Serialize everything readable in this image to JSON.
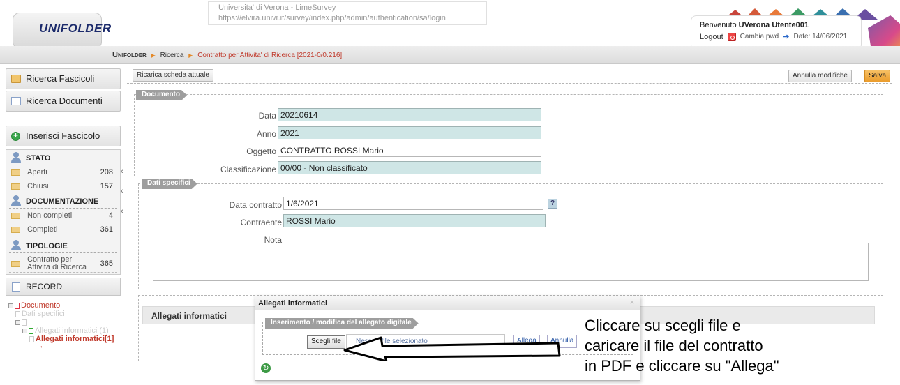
{
  "header": {
    "logo": "UNIFOLDER",
    "tooltip": {
      "line1": "Universita' di Verona - LimeSurvey",
      "line2": "https://elvira.univr.it/survey/index.php/admin/authentication/sa/login"
    },
    "user": {
      "welcome_prefix": "Benvenuto",
      "username": "UVerona Utente001",
      "logout": "Logout",
      "change_pwd": "Cambia pwd",
      "date": "Date: 14/06/2021"
    }
  },
  "breadcrumb": {
    "brand": "Unifolder",
    "items": [
      "Ricerca",
      "Contratto per Attivita' di Ricerca [2021-0/0.216]"
    ]
  },
  "sidebar": {
    "ricerca_fascicoli": "Ricerca Fascicoli",
    "ricerca_documenti": "Ricerca Documenti",
    "inserisci_fascicolo": "Inserisci Fascicolo",
    "sections": {
      "stato": {
        "title": "STATO",
        "items": [
          {
            "label": "Aperti",
            "count": "208"
          },
          {
            "label": "Chiusi",
            "count": "157"
          }
        ]
      },
      "documentazione": {
        "title": "DOCUMENTAZIONE",
        "items": [
          {
            "label": "Non completi",
            "count": "4"
          },
          {
            "label": "Completi",
            "count": "361"
          }
        ]
      },
      "tipologie": {
        "title": "TIPOLOGIE",
        "items": [
          {
            "label_line1": "Contratto per",
            "label_line2": "Attivita di Ricerca",
            "count": "365"
          }
        ]
      }
    },
    "record": "RECORD",
    "tree": {
      "documento": "Documento",
      "dati_specifici": "Dati specifici",
      "allegati_group": "Allegati informatici (1)",
      "allegati_item": "Allegati informatici[1]",
      "arrow": "←"
    }
  },
  "toolbar": {
    "reload": "Ricarica scheda attuale",
    "cancel": "Annulla modifiche",
    "save": "Salva"
  },
  "documento": {
    "legend": "Documento",
    "fields": {
      "data": {
        "label": "Data",
        "value": "20210614"
      },
      "anno": {
        "label": "Anno",
        "value": "2021"
      },
      "oggetto": {
        "label": "Oggetto",
        "value": "CONTRATTO ROSSI Mario"
      },
      "classificazione": {
        "label": "Classificazione",
        "value": "00/00 - Non classificato"
      }
    }
  },
  "dati_specifici": {
    "legend": "Dati specifici",
    "fields": {
      "data_contratto": {
        "label": "Data contratto",
        "value": "1/6/2021"
      },
      "contraente": {
        "label": "Contraente",
        "value": "ROSSI Mario"
      },
      "nota": {
        "label": "Nota",
        "value": ""
      }
    },
    "help": "?"
  },
  "allegati": {
    "title": "Allegati informatici"
  },
  "modal": {
    "title": "Allegati informatici",
    "close": "×",
    "legend": "Inserimento / modifica del allegato digitale",
    "choose_file": "Scegli file",
    "no_file": "Nessun file selezionato",
    "attach": "Allega",
    "cancel": "Annulla",
    "refresh": "↻"
  },
  "annotation": {
    "line1": "Cliccare su scegli file e",
    "line2": "caricare il file del contratto",
    "line3": "in PDF e cliccare su \"Allega\""
  },
  "colors": {
    "accent_orange": "#eb9c2c",
    "field_teal": "#cfe6e6",
    "breadcrumb_current": "#c0392b",
    "legend_grey": "#9e9e9e"
  }
}
